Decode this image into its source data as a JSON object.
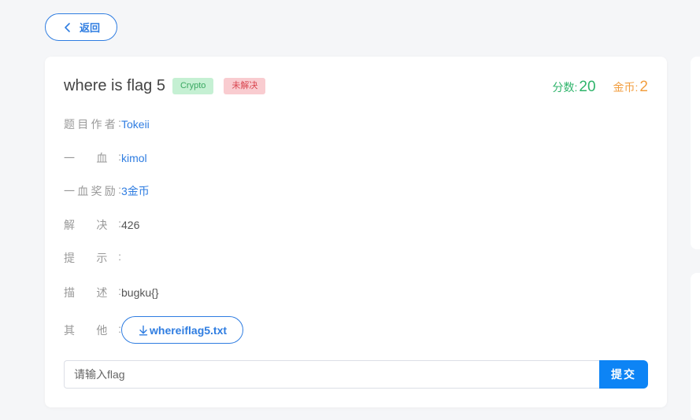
{
  "back": {
    "label": "返回",
    "icon": "chevron-left-icon"
  },
  "challenge": {
    "title": "where is flag 5",
    "category": "Crypto",
    "status": "未解决",
    "score_label": "分数:",
    "score": "20",
    "coin_label": "金币:",
    "coins": "2"
  },
  "fields": {
    "author": {
      "label_chars": [
        "题",
        "目",
        "作",
        "者"
      ],
      "colon": ":",
      "value": "Tokeii"
    },
    "first_blood": {
      "label_chars": [
        "一",
        "血"
      ],
      "colon": ":",
      "value": "kimol"
    },
    "first_blood_reward": {
      "label_chars": [
        "一",
        "血",
        "奖",
        "励"
      ],
      "colon": ":",
      "value": "3金币"
    },
    "solved": {
      "label_chars": [
        "解",
        "决"
      ],
      "colon": ":",
      "value": "426"
    },
    "hint": {
      "label_chars": [
        "提",
        "示"
      ],
      "colon": ":",
      "value": ""
    },
    "description": {
      "label_chars": [
        "描",
        "述"
      ],
      "colon": ":",
      "value": "bugku{}"
    },
    "other": {
      "label_chars": [
        "其",
        "他"
      ],
      "colon": ":",
      "file_name": "whereiflag5.txt",
      "icon": "download-icon"
    }
  },
  "flag_form": {
    "placeholder": "请输入flag",
    "value": "",
    "submit_label": "提交"
  },
  "colors": {
    "accent": "#2f7de1",
    "score": "#2fb46b",
    "coins": "#f29e3f",
    "submit": "#0d84f5"
  }
}
